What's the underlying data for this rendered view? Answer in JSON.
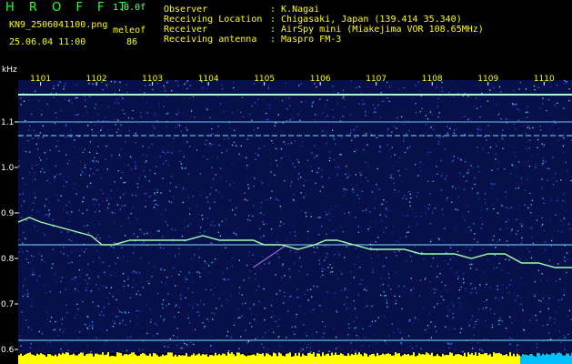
{
  "header": {
    "app_title": "H R O F F T",
    "version": "1.0.0f",
    "filename": "KN9_2506041100.png",
    "station_label": "meleof",
    "station_value": "86",
    "datetime": "25.06.04 11:00",
    "fields": [
      {
        "label": "Observer",
        "value": ": K.Nagai"
      },
      {
        "label": "Receiving Location",
        "value": ": Chigasaki, Japan (139.414 35.340)"
      },
      {
        "label": "Receiver",
        "value": ": AirSpy mini (Miakejima VOR 108.65MHz)"
      },
      {
        "label": "Receiving antenna",
        "value": ": Maspro FM-3"
      }
    ]
  },
  "colors": {
    "text": "#ffff00",
    "title": "#2fff2f",
    "signal": "#a0ffb0",
    "bg_noise": "#101a80",
    "bottom_bar": "#ffff00",
    "bottom_bar_alt": "#00bfff"
  },
  "spectrogram": {
    "y_unit": "kHz",
    "y_ticks": [
      "1.1",
      "1.0",
      "0.9",
      "0.8",
      "0.7",
      "0.6"
    ],
    "x_ticks": [
      "1101",
      "1102",
      "1103",
      "1104",
      "1105",
      "1106",
      "1107",
      "1108",
      "1109",
      "1110"
    ],
    "ylim": [
      0.6,
      1.2
    ],
    "xlim": [
      1100.6,
      1110.5
    ],
    "carrier_lines_khz": [
      1.16,
      1.1,
      1.07,
      0.83,
      0.62
    ],
    "signal_trace": {
      "x": [
        1100.6,
        1100.8,
        1101.0,
        1101.3,
        1101.6,
        1101.9,
        1102.0,
        1102.1,
        1102.3,
        1102.6,
        1102.9,
        1103.2,
        1103.6,
        1103.9,
        1104.2,
        1104.5,
        1104.8,
        1105.0,
        1105.3,
        1105.6,
        1105.9,
        1106.1,
        1106.3,
        1106.6,
        1106.9,
        1107.2,
        1107.5,
        1107.8,
        1108.1,
        1108.4,
        1108.7,
        1109.0,
        1109.3,
        1109.6,
        1109.9,
        1110.2,
        1110.5
      ],
      "y": [
        0.88,
        0.89,
        0.88,
        0.87,
        0.86,
        0.85,
        0.84,
        0.83,
        0.83,
        0.84,
        0.84,
        0.84,
        0.84,
        0.85,
        0.84,
        0.84,
        0.84,
        0.83,
        0.83,
        0.82,
        0.83,
        0.84,
        0.84,
        0.83,
        0.82,
        0.82,
        0.82,
        0.81,
        0.81,
        0.81,
        0.8,
        0.81,
        0.81,
        0.79,
        0.79,
        0.78,
        0.78
      ]
    },
    "meteor_streak": {
      "x": [
        1104.8,
        1105.4
      ],
      "y": [
        0.78,
        0.83
      ]
    }
  }
}
